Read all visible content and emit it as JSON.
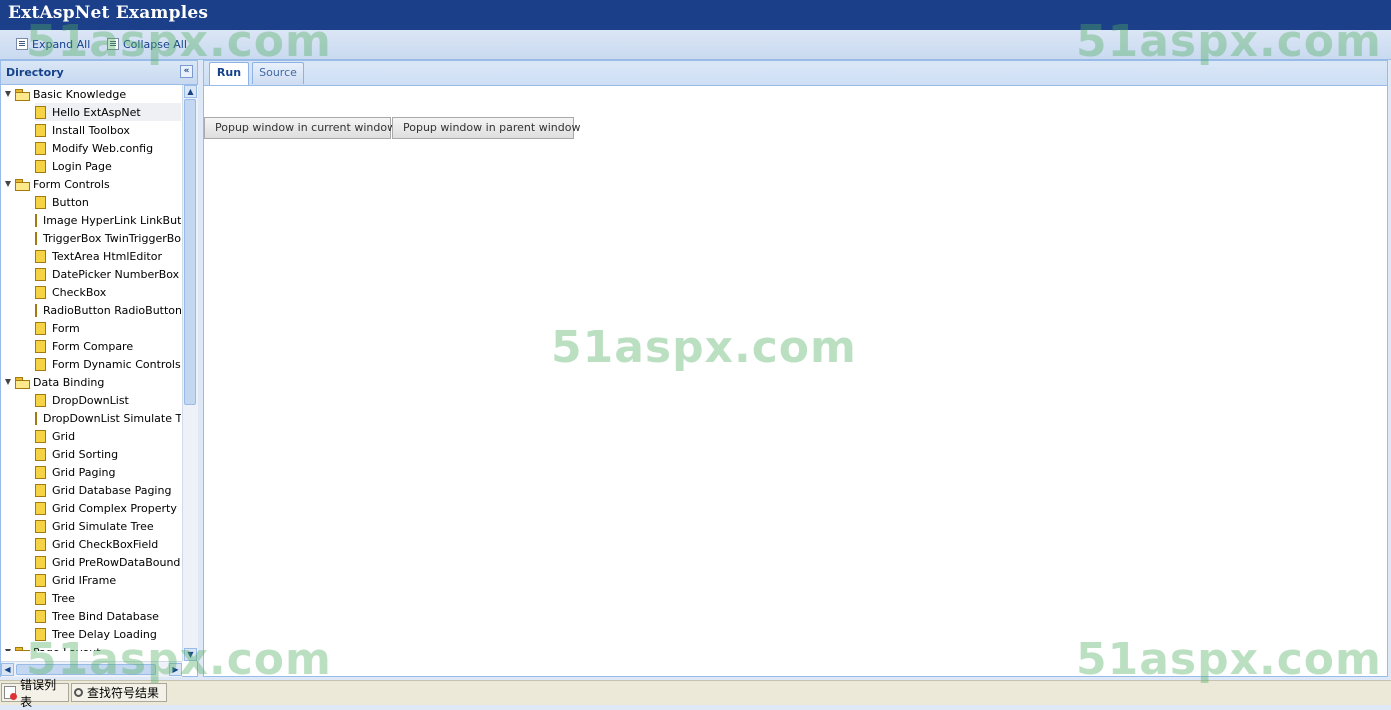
{
  "app": {
    "title": "ExtAspNet Examples"
  },
  "toolbar": {
    "expand_all": "Expand All",
    "collapse_all": "Collapse All"
  },
  "directory": {
    "title": "Directory",
    "items": [
      {
        "label": "Basic Knowledge",
        "type": "folder"
      },
      {
        "label": "Hello ExtAspNet",
        "type": "leaf",
        "selected": true
      },
      {
        "label": "Install Toolbox",
        "type": "leaf"
      },
      {
        "label": "Modify Web.config",
        "type": "leaf"
      },
      {
        "label": "Login Page",
        "type": "leaf"
      },
      {
        "label": "Form Controls",
        "type": "folder"
      },
      {
        "label": "Button",
        "type": "leaf"
      },
      {
        "label": "Image HyperLink LinkButton",
        "type": "leaf"
      },
      {
        "label": "TriggerBox TwinTriggerBox",
        "type": "leaf"
      },
      {
        "label": "TextArea HtmlEditor",
        "type": "leaf"
      },
      {
        "label": "DatePicker NumberBox",
        "type": "leaf"
      },
      {
        "label": "CheckBox",
        "type": "leaf"
      },
      {
        "label": "RadioButton RadioButtonList",
        "type": "leaf"
      },
      {
        "label": "Form",
        "type": "leaf"
      },
      {
        "label": "Form Compare",
        "type": "leaf"
      },
      {
        "label": "Form Dynamic Controls",
        "type": "leaf"
      },
      {
        "label": "Data Binding",
        "type": "folder"
      },
      {
        "label": "DropDownList",
        "type": "leaf"
      },
      {
        "label": "DropDownList Simulate Tree",
        "type": "leaf"
      },
      {
        "label": "Grid",
        "type": "leaf"
      },
      {
        "label": "Grid Sorting",
        "type": "leaf"
      },
      {
        "label": "Grid Paging",
        "type": "leaf"
      },
      {
        "label": "Grid Database Paging",
        "type": "leaf"
      },
      {
        "label": "Grid Complex Property",
        "type": "leaf"
      },
      {
        "label": "Grid Simulate Tree",
        "type": "leaf"
      },
      {
        "label": "Grid CheckBoxField",
        "type": "leaf"
      },
      {
        "label": "Grid PreRowDataBound",
        "type": "leaf"
      },
      {
        "label": "Grid IFrame",
        "type": "leaf"
      },
      {
        "label": "Tree",
        "type": "leaf"
      },
      {
        "label": "Tree Bind Database",
        "type": "leaf"
      },
      {
        "label": "Tree Delay Loading",
        "type": "leaf"
      },
      {
        "label": "Page Layout",
        "type": "folder"
      }
    ]
  },
  "tabs": [
    {
      "label": "Run",
      "active": true
    },
    {
      "label": "Source",
      "active": false
    }
  ],
  "main": {
    "buttons": [
      "Popup window in current window",
      "Popup window in parent window"
    ]
  },
  "taskbar": {
    "items": [
      "错误列表",
      "查找符号结果"
    ]
  },
  "watermark": {
    "text": "51aspx.com"
  },
  "colors": {
    "header": "#1c3f8a",
    "panel_border": "#99bbe8",
    "accent": "#15428b"
  }
}
